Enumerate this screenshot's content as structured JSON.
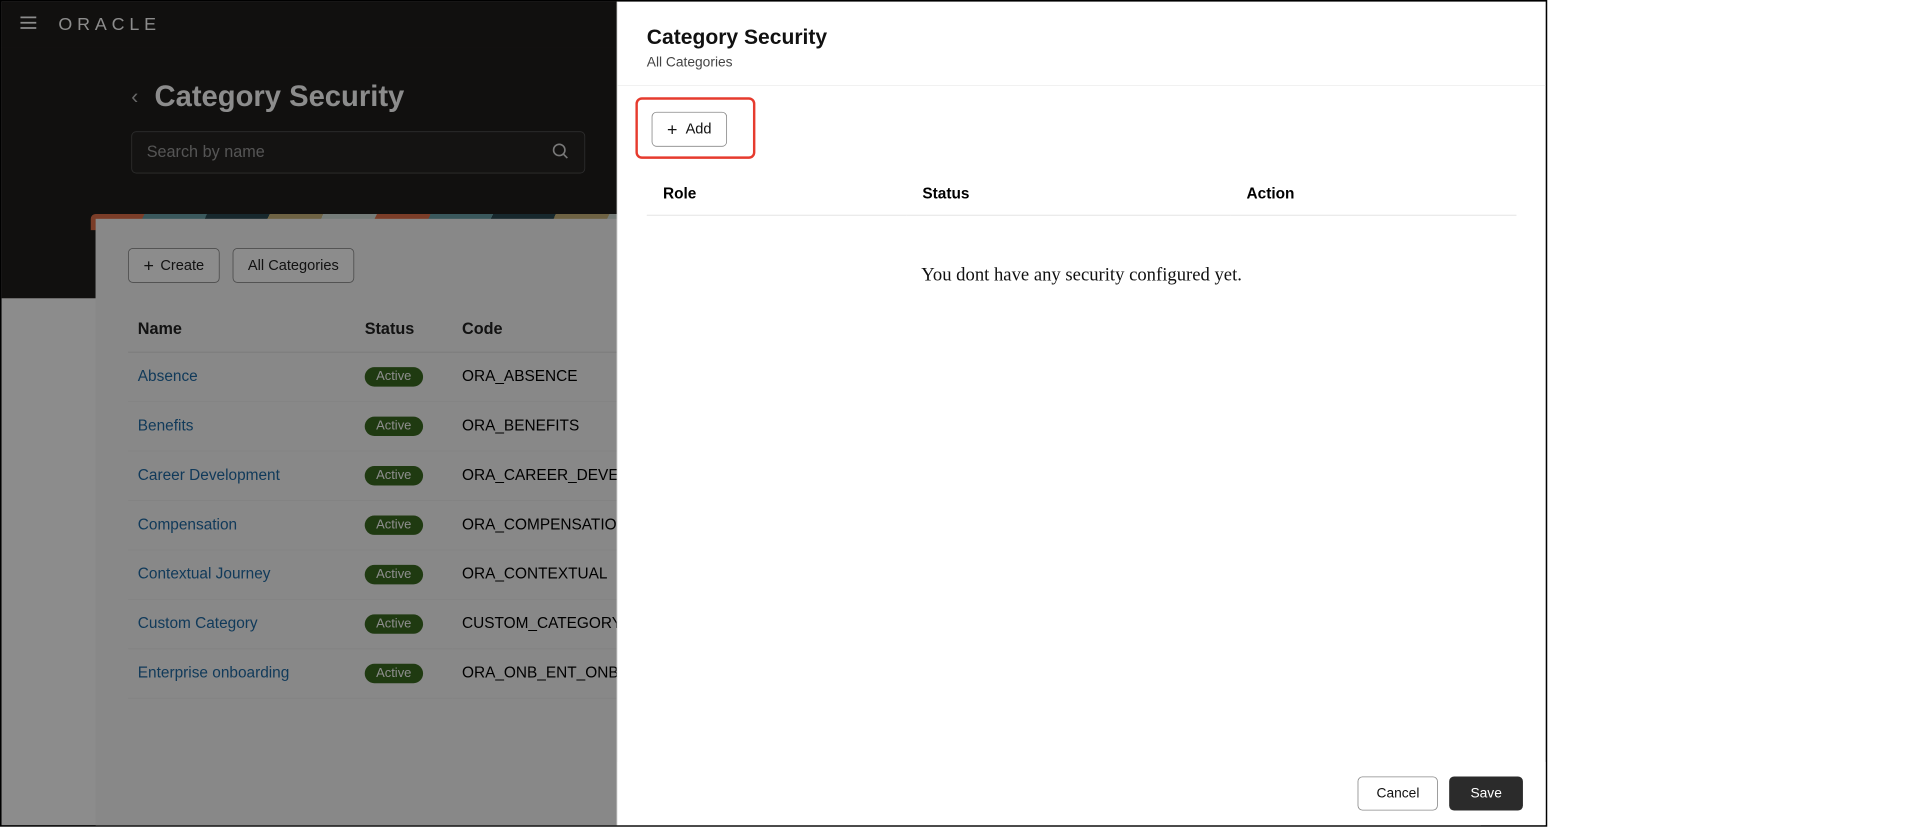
{
  "brand": "ORACLE",
  "page": {
    "title": "Category Security",
    "search_placeholder": "Search by name"
  },
  "toolbar": {
    "create_label": "Create",
    "all_categories_label": "All Categories"
  },
  "table": {
    "headers": {
      "name": "Name",
      "status": "Status",
      "code": "Code"
    },
    "rows": [
      {
        "name": "Absence",
        "status": "Active",
        "code": "ORA_ABSENCE"
      },
      {
        "name": "Benefits",
        "status": "Active",
        "code": "ORA_BENEFITS"
      },
      {
        "name": "Career Development",
        "status": "Active",
        "code": "ORA_CAREER_DEVELO"
      },
      {
        "name": "Compensation",
        "status": "Active",
        "code": "ORA_COMPENSATION"
      },
      {
        "name": "Contextual Journey",
        "status": "Active",
        "code": "ORA_CONTEXTUAL"
      },
      {
        "name": "Custom Category",
        "status": "Active",
        "code": "CUSTOM_CATEGORY"
      },
      {
        "name": "Enterprise onboarding",
        "status": "Active",
        "code": "ORA_ONB_ENT_ONBO"
      }
    ]
  },
  "panel": {
    "title": "Category Security",
    "subtitle": "All Categories",
    "add_label": "Add",
    "headers": {
      "role": "Role",
      "status": "Status",
      "action": "Action"
    },
    "empty_message": "You dont have any security configured yet.",
    "cancel_label": "Cancel",
    "save_label": "Save"
  }
}
